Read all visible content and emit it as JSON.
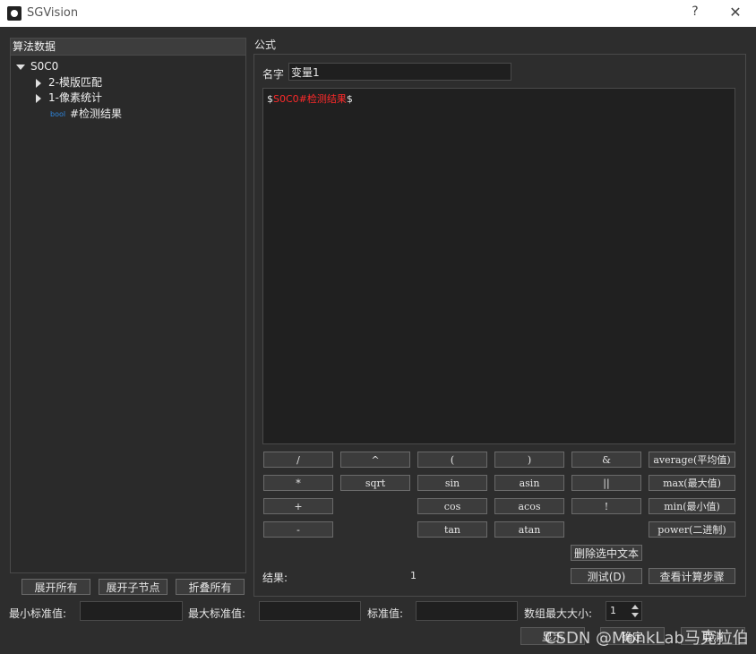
{
  "window": {
    "title": "SGVision",
    "help": "?",
    "close": "✕"
  },
  "left_panel": {
    "header": "算法数据",
    "tree": {
      "root": "S0C0",
      "children": [
        "2-模版匹配",
        "1-像素统计"
      ],
      "bool_badge": "bool",
      "leaf": "#检测结果"
    },
    "buttons": {
      "expand_all": "展开所有",
      "expand_children": "展开子节点",
      "collapse_all": "折叠所有"
    }
  },
  "formula": {
    "section_title": "公式",
    "name_label": "名字",
    "name_value": "变量1",
    "expr_prefix": "$",
    "expr_var": "S0C0#检测结果",
    "expr_suffix": "$",
    "operators": [
      [
        "/",
        "^",
        "(",
        ")",
        "&",
        "average(平均值)"
      ],
      [
        "*",
        "sqrt",
        "sin",
        "asin",
        "||",
        "max(最大值)"
      ],
      [
        "+",
        "",
        "cos",
        "acos",
        "!",
        "min(最小值)"
      ],
      [
        "-",
        "",
        "tan",
        "atan",
        "",
        "power(二进制)"
      ]
    ],
    "delete_selected": "删除选中文本",
    "result_label": "结果:",
    "result_value": "1",
    "test_button": "测试(D)",
    "view_steps_button": "查看计算步骤"
  },
  "bottom": {
    "min_std_label": "最小标准值:",
    "max_std_label": "最大标准值:",
    "std_label": "标准值:",
    "array_max_label": "数组最大大小:",
    "array_max_value": "1",
    "show_btn": "显示",
    "confirm_btn": "确定",
    "cancel_btn": "取消"
  },
  "watermark": "CSDN @MonkLab马克拉伯"
}
